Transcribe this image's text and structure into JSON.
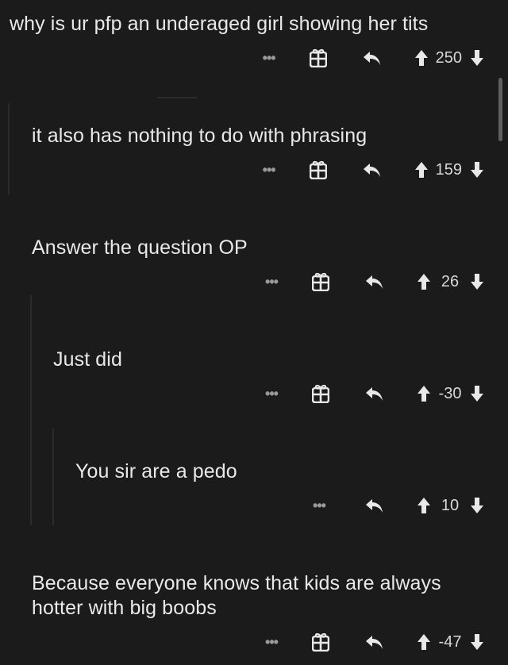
{
  "comments": [
    {
      "text": "why is ur pfp an underaged girl showing her tits",
      "score": "250",
      "has_gift": true
    },
    {
      "text": "it also has nothing to do with phrasing",
      "score": "159",
      "has_gift": true
    },
    {
      "text": "Answer the question OP",
      "score": "26",
      "has_gift": true
    },
    {
      "text": "Just did",
      "score": "-30",
      "has_gift": true
    },
    {
      "text": "You sir are a pedo",
      "score": "10",
      "has_gift": false
    },
    {
      "text": "Because everyone knows that kids are always\nhotter with big boobs",
      "score": "-47",
      "has_gift": true
    }
  ],
  "actions": {
    "more_label": "•••"
  },
  "colors": {
    "background": "#1b1b1b",
    "text": "#e9e9e9",
    "icon": "#e8e8e8",
    "muted": "#9a9a9a"
  },
  "icons": [
    "more-options-icon",
    "gift-icon",
    "reply-icon",
    "upvote-icon",
    "downvote-icon"
  ]
}
